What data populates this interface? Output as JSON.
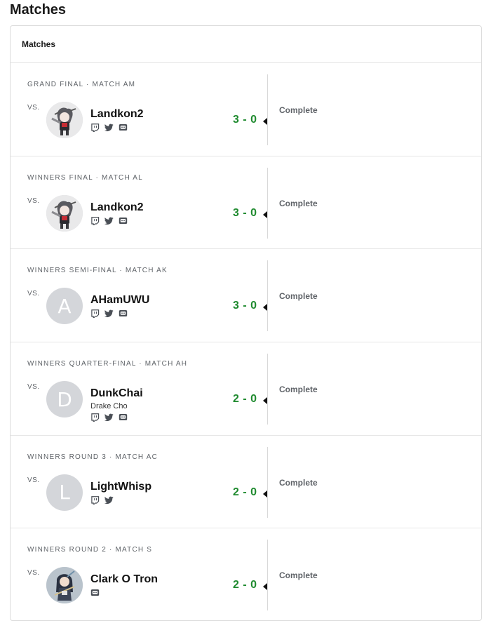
{
  "page_title": "Matches",
  "card_header": "Matches",
  "vs_label": "VS.",
  "icons": {
    "twitch": "twitch-icon",
    "twitter": "twitter-icon",
    "discord": "discord-icon"
  },
  "colors": {
    "score": "#1e8a2e",
    "avatar_placeholder": "#d4d6da",
    "muted_text": "#5f6368"
  },
  "matches": [
    {
      "round": "GRAND FINAL · MATCH AM",
      "player": "Landkon2",
      "subname": "",
      "avatar": "image",
      "avatar_letter": "",
      "socials": [
        "twitch",
        "twitter",
        "discord"
      ],
      "score": "3 - 0",
      "status": "Complete"
    },
    {
      "round": "WINNERS FINAL · MATCH AL",
      "player": "Landkon2",
      "subname": "",
      "avatar": "image",
      "avatar_letter": "",
      "socials": [
        "twitch",
        "twitter",
        "discord"
      ],
      "score": "3 - 0",
      "status": "Complete"
    },
    {
      "round": "WINNERS SEMI-FINAL · MATCH AK",
      "player": "AHamUWU",
      "subname": "",
      "avatar": "letter",
      "avatar_letter": "A",
      "socials": [
        "twitch",
        "twitter",
        "discord"
      ],
      "score": "3 - 0",
      "status": "Complete"
    },
    {
      "round": "WINNERS QUARTER-FINAL · MATCH AH",
      "player": "DunkChai",
      "subname": "Drake Cho",
      "avatar": "letter",
      "avatar_letter": "D",
      "socials": [
        "twitch",
        "twitter",
        "discord"
      ],
      "score": "2 - 0",
      "status": "Complete"
    },
    {
      "round": "WINNERS ROUND 3 · MATCH AC",
      "player": "LightWhisp",
      "subname": "",
      "avatar": "letter",
      "avatar_letter": "L",
      "socials": [
        "twitch",
        "twitter"
      ],
      "score": "2 - 0",
      "status": "Complete"
    },
    {
      "round": "WINNERS ROUND 2 · MATCH S",
      "player": "Clark O Tron",
      "subname": "",
      "avatar": "image2",
      "avatar_letter": "",
      "socials": [
        "discord"
      ],
      "score": "2 - 0",
      "status": "Complete"
    }
  ]
}
